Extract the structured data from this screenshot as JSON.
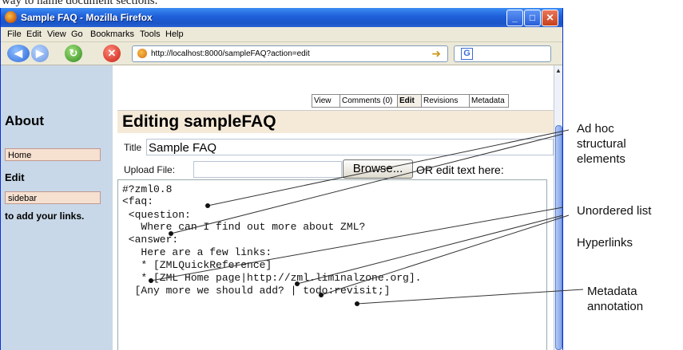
{
  "caption_top": "way to name document sections.",
  "window": {
    "title": "Sample FAQ - Mozilla Firefox",
    "controls": {
      "minimize": "_",
      "maximize": "□",
      "close": "✕"
    }
  },
  "menu": [
    "File",
    "Edit",
    "View",
    "Go",
    "Bookmarks",
    "Tools",
    "Help"
  ],
  "nav": {
    "url": "http://localhost:8000/sampleFAQ?action=edit",
    "search_engine": "G"
  },
  "sidebar": {
    "about": "About",
    "home": "Home",
    "edit": "Edit",
    "sidebar_link": "sidebar",
    "add_links": "to add your links."
  },
  "tabs": [
    "View",
    "Comments (0)",
    "Edit",
    "Revisions",
    "Metadata"
  ],
  "active_tab": "Edit",
  "editor": {
    "heading": "Editing sampleFAQ",
    "title_label": "Title",
    "title_value": "Sample FAQ",
    "upload_label": "Upload File:",
    "browse_label": "Browse...",
    "or_text": "OR edit text here:",
    "code": [
      "#?zml0.8",
      "<faq:",
      " <question:",
      "   Where can I find out more about ZML?",
      " <answer:",
      "   Here are a few links:",
      "   * [ZMLQuickReference]",
      "   * [ZML Home page|http://zml.liminalzone.org].",
      "  [Any more we should add? | todo:revisit;]"
    ]
  },
  "callouts": {
    "structural": "Ad hoc\nstructural\nelements",
    "unordered": "Unordered list",
    "hyperlinks": "Hyperlinks",
    "metadata": "Metadata\nannotation"
  }
}
